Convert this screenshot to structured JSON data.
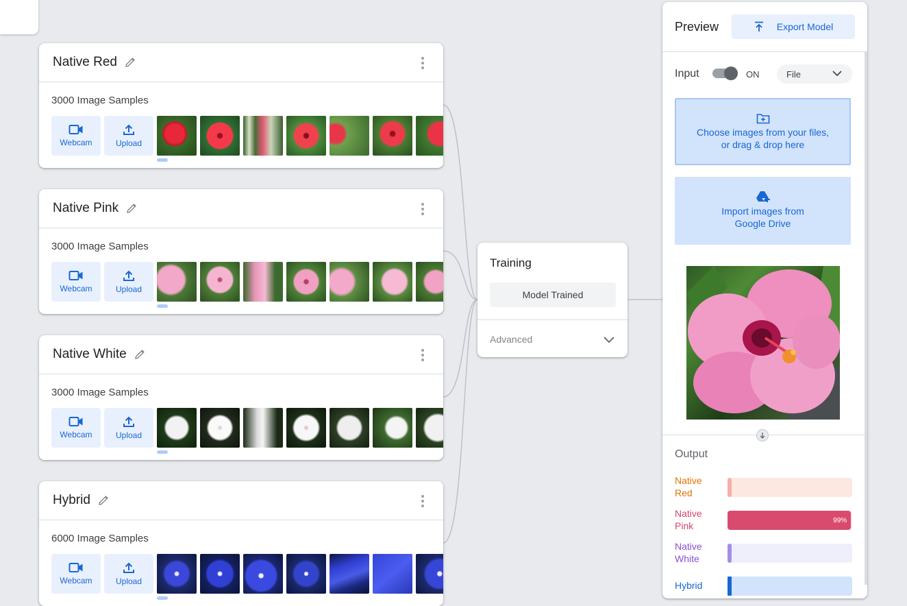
{
  "classes": [
    {
      "name": "Native Red",
      "samples": "3000 Image Samples",
      "webcam_label": "Webcam",
      "upload_label": "Upload",
      "thumbs": [
        "t-red1",
        "t-red2",
        "t-red3",
        "t-red4",
        "t-red5",
        "t-red6",
        "t-red7"
      ]
    },
    {
      "name": "Native Pink",
      "samples": "3000 Image Samples",
      "webcam_label": "Webcam",
      "upload_label": "Upload",
      "thumbs": [
        "t-pink1",
        "t-pink2",
        "t-pink3",
        "t-pink4",
        "t-pink5",
        "t-pink6",
        "t-pink7"
      ]
    },
    {
      "name": "Native White",
      "samples": "3000 Image Samples",
      "webcam_label": "Webcam",
      "upload_label": "Upload",
      "thumbs": [
        "t-white1",
        "t-white2",
        "t-white3",
        "t-white4",
        "t-white5",
        "t-white6",
        "t-white7"
      ]
    },
    {
      "name": "Hybrid",
      "samples": "6000 Image Samples",
      "webcam_label": "Webcam",
      "upload_label": "Upload",
      "thumbs": [
        "t-blue1",
        "t-blue2",
        "t-blue3",
        "t-blue4",
        "t-blue5",
        "t-blue6",
        "t-blue7"
      ]
    }
  ],
  "training": {
    "title": "Training",
    "status_button": "Model Trained",
    "advanced_label": "Advanced"
  },
  "preview": {
    "title": "Preview",
    "export_label": "Export Model",
    "input_label": "Input",
    "toggle_state": "ON",
    "input_source": "File",
    "drop_zone_line1": "Choose images from your files,",
    "drop_zone_line2": "or drag & drop here",
    "drive_line1": "Import images from",
    "drive_line2": "Google Drive",
    "output_label": "Output",
    "outputs": [
      {
        "label_line1": "Native",
        "label_line2": "Red",
        "color": "#e37400",
        "bar_bg": "#fce8e0",
        "bar_fill": "#f6aea9",
        "value": 0.0,
        "value_text": ""
      },
      {
        "label_line1": "Native",
        "label_line2": "Pink",
        "color": "#d6456b",
        "bar_bg": "#fbe3ea",
        "bar_fill": "#d94b6e",
        "value": 0.99,
        "value_text": "99%"
      },
      {
        "label_line1": "Native",
        "label_line2": "White",
        "color": "#8a4fd6",
        "bar_bg": "#efeefb",
        "bar_fill": "#a58ee6",
        "value": 0.0,
        "value_text": ""
      },
      {
        "label_line1": "Hybrid",
        "label_line2": "",
        "color": "#1967d2",
        "bar_bg": "#d2e3fc",
        "bar_fill": "#1967d2",
        "value": 0.01,
        "value_text": ""
      }
    ]
  },
  "icons": {
    "edit": "pencil-icon",
    "more": "kebab-menu-icon",
    "webcam": "videocam-icon",
    "upload": "upload-icon",
    "export": "export-upload-icon",
    "chevron": "chevron-down-icon",
    "folder": "folder-add-icon",
    "drive": "google-drive-icon",
    "arrow": "arrow-down-icon"
  }
}
